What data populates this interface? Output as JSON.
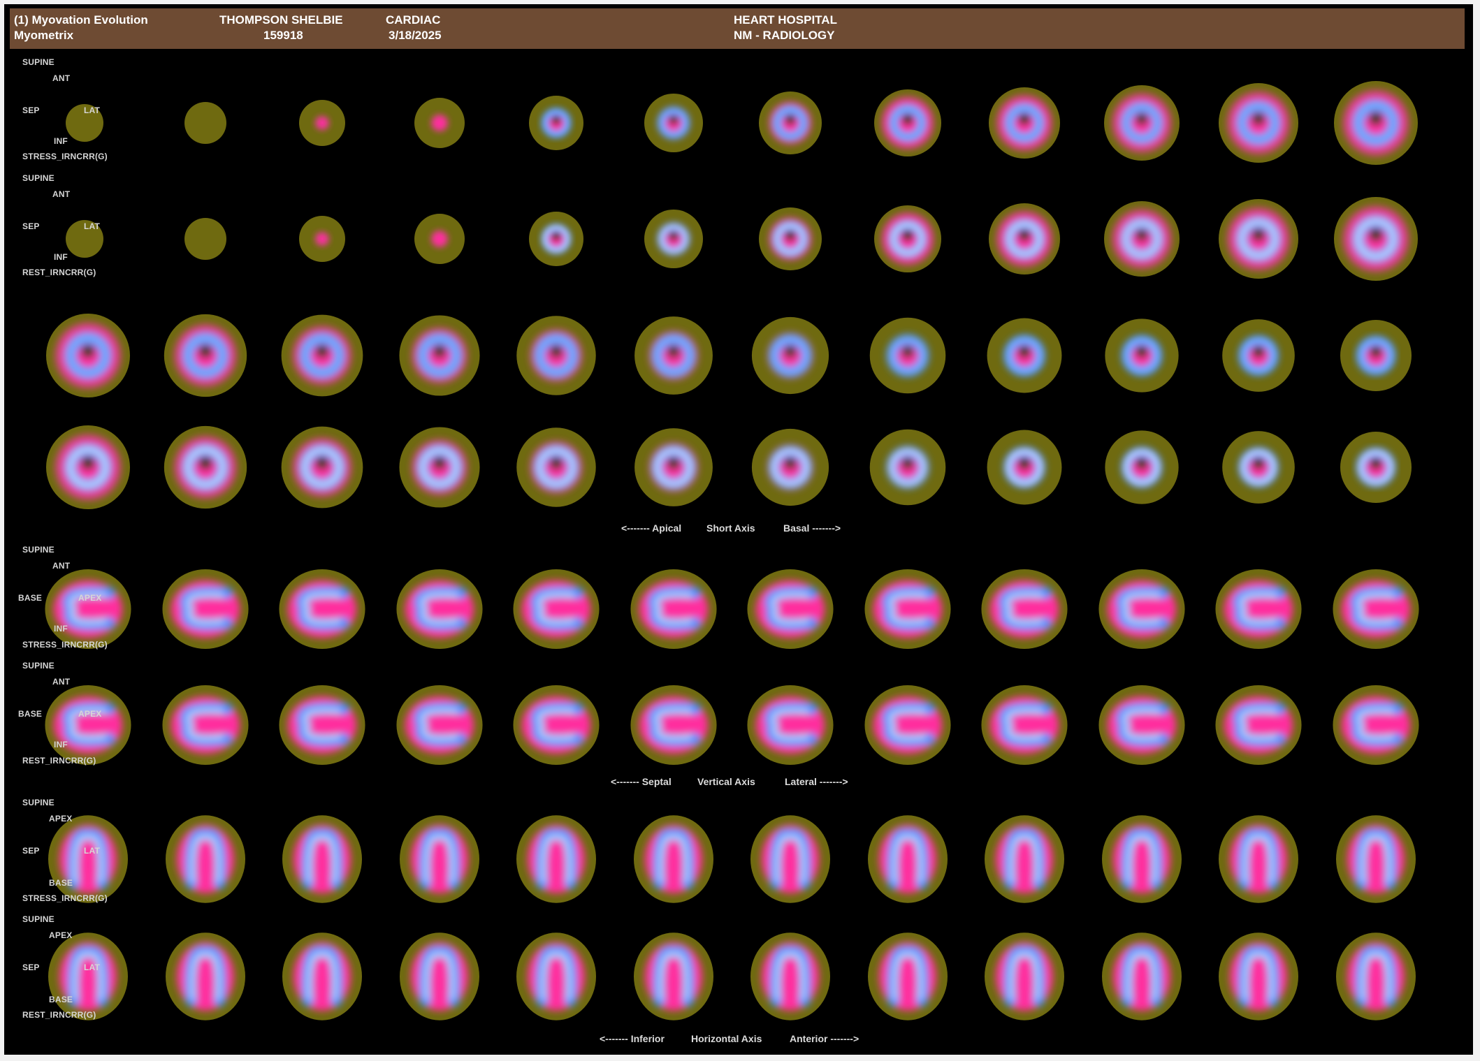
{
  "header": {
    "app_title": "(1) Myovation Evolution",
    "app_subtitle": "Myometrix",
    "patient_name": "THOMPSON SHELBIE",
    "patient_id": "159918",
    "study_type": "CARDIAC",
    "study_date": "3/18/2025",
    "institution": "HEART HOSPITAL",
    "department": "NM - RADIOLOGY"
  },
  "orientation_labels": {
    "supine": "SUPINE",
    "ant": "ANT",
    "inf": "INF",
    "sep": "SEP",
    "lat": "LAT",
    "base": "BASE",
    "apex": "APEX"
  },
  "series_labels": {
    "stress": "STRESS_IRNCRR(G)",
    "rest": "REST_IRNCRR(G)"
  },
  "axis_captions": {
    "short_axis": {
      "left": "<------- Apical",
      "center": "Short Axis",
      "right": "Basal ------->"
    },
    "vertical_axis": {
      "left": "<------- Septal",
      "center": "Vertical Axis",
      "right": "Lateral ------->"
    },
    "horizontal_axis": {
      "left": "<------- Inferior",
      "center": "Horizontal Axis",
      "right": "Anterior ------->"
    }
  },
  "colormap": {
    "outer": "#6f6a10",
    "mid": "#e83a9a",
    "inner": "#ff2f9e",
    "hot": "#3b8cff",
    "peak": "#ffffff",
    "cavity": "#2a3a08"
  },
  "slice_counts": {
    "per_row": 12,
    "rows": 8
  }
}
